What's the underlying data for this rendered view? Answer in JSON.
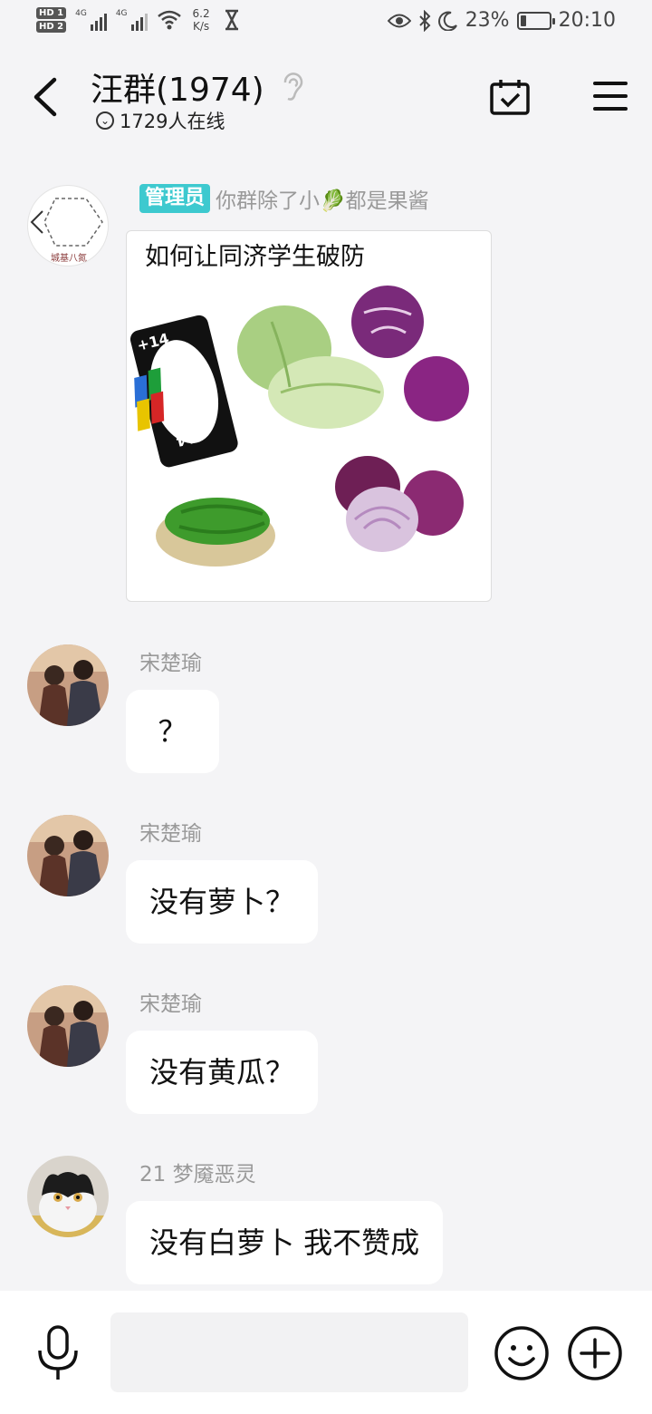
{
  "status": {
    "hd1": "HD 1",
    "hd2": "HD 2",
    "net1": "4G",
    "net2": "4G",
    "speed_value": "6.2",
    "speed_unit": "K/s",
    "battery_percent": "23%",
    "battery_level": 0.23,
    "time": "20:10"
  },
  "header": {
    "title": "汪群(1974)",
    "online_count": "1729人在线"
  },
  "messages": [
    {
      "badge": "管理员",
      "sender": "你群除了小🥬都是果酱",
      "image_caption": "如何让同济学生破防",
      "avatar_text": "城基八氮",
      "card_label_top": "+14",
      "card_label_bottom": "+14"
    },
    {
      "sender": "宋楚瑜",
      "text": "？"
    },
    {
      "sender": "宋楚瑜",
      "text": "没有萝卜？"
    },
    {
      "sender": "宋楚瑜",
      "text": "没有黄瓜？"
    },
    {
      "sender": "21 梦魇恶灵",
      "text": "没有白萝卜 我不赞成"
    }
  ],
  "icons": {
    "back": "back-arrow-icon",
    "hearing": "ear-icon",
    "calendar": "calendar-check-icon",
    "menu": "hamburger-menu-icon",
    "mic": "microphone-icon",
    "emoji": "smiley-icon",
    "plus": "plus-circle-icon"
  }
}
